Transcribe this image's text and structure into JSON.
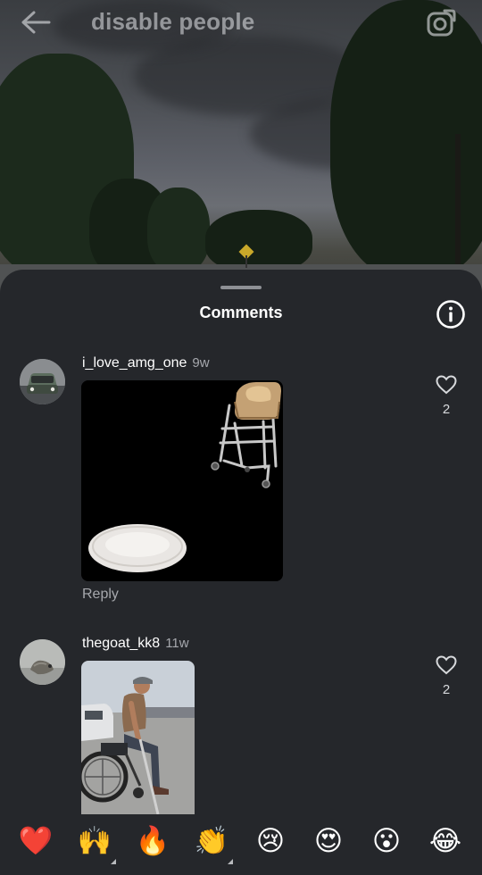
{
  "header": {
    "title": "disable people",
    "back_icon": "arrow-left-icon",
    "camera_icon": "camera-icon"
  },
  "comments_sheet": {
    "title": "Comments",
    "info_icon": "info-icon"
  },
  "comments": [
    {
      "username": "i_love_amg_one",
      "time": "9w",
      "reply_label": "Reply",
      "like_count": "2",
      "media": "sticker of a pet bed and a walker with a seat on black background"
    },
    {
      "username": "thegoat_kk8",
      "time": "11w",
      "like_count": "2",
      "media": "photo of a man in a wheelchair holding a crutch in a parking lot"
    }
  ],
  "emoji_bar": {
    "emojis": [
      "❤️",
      "🙌",
      "🔥",
      "👏",
      "😢",
      "😍",
      "😮",
      "😂"
    ]
  },
  "colors": {
    "sheet_bg": "#25272b",
    "secondary_text": "#a6a8ad",
    "heart": "#e8262d"
  }
}
